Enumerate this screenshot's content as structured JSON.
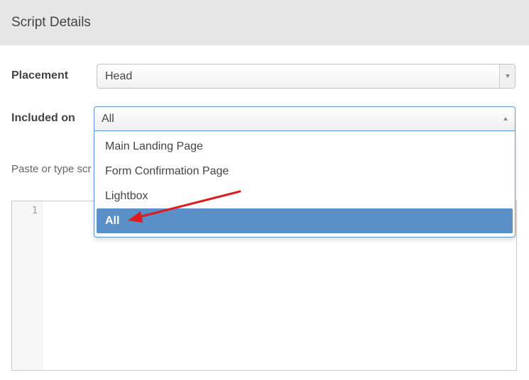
{
  "panel": {
    "title": "Script Details"
  },
  "placement": {
    "label": "Placement",
    "value": "Head"
  },
  "included_on": {
    "label": "Included on",
    "value": "All",
    "options": [
      "Main Landing Page",
      "Form Confirmation Page",
      "Lightbox",
      "All"
    ],
    "selected_index": 3
  },
  "script": {
    "hint": "Paste or type scr",
    "line_number": "1"
  },
  "colors": {
    "accent": "#5a8fc7",
    "annotation_arrow": "#e01b1b",
    "header_bg": "#e6e6e6"
  },
  "icons": {
    "select_closed": "chevron-down-icon",
    "select_open": "chevron-up-icon",
    "annotation": "red-arrow-icon"
  }
}
